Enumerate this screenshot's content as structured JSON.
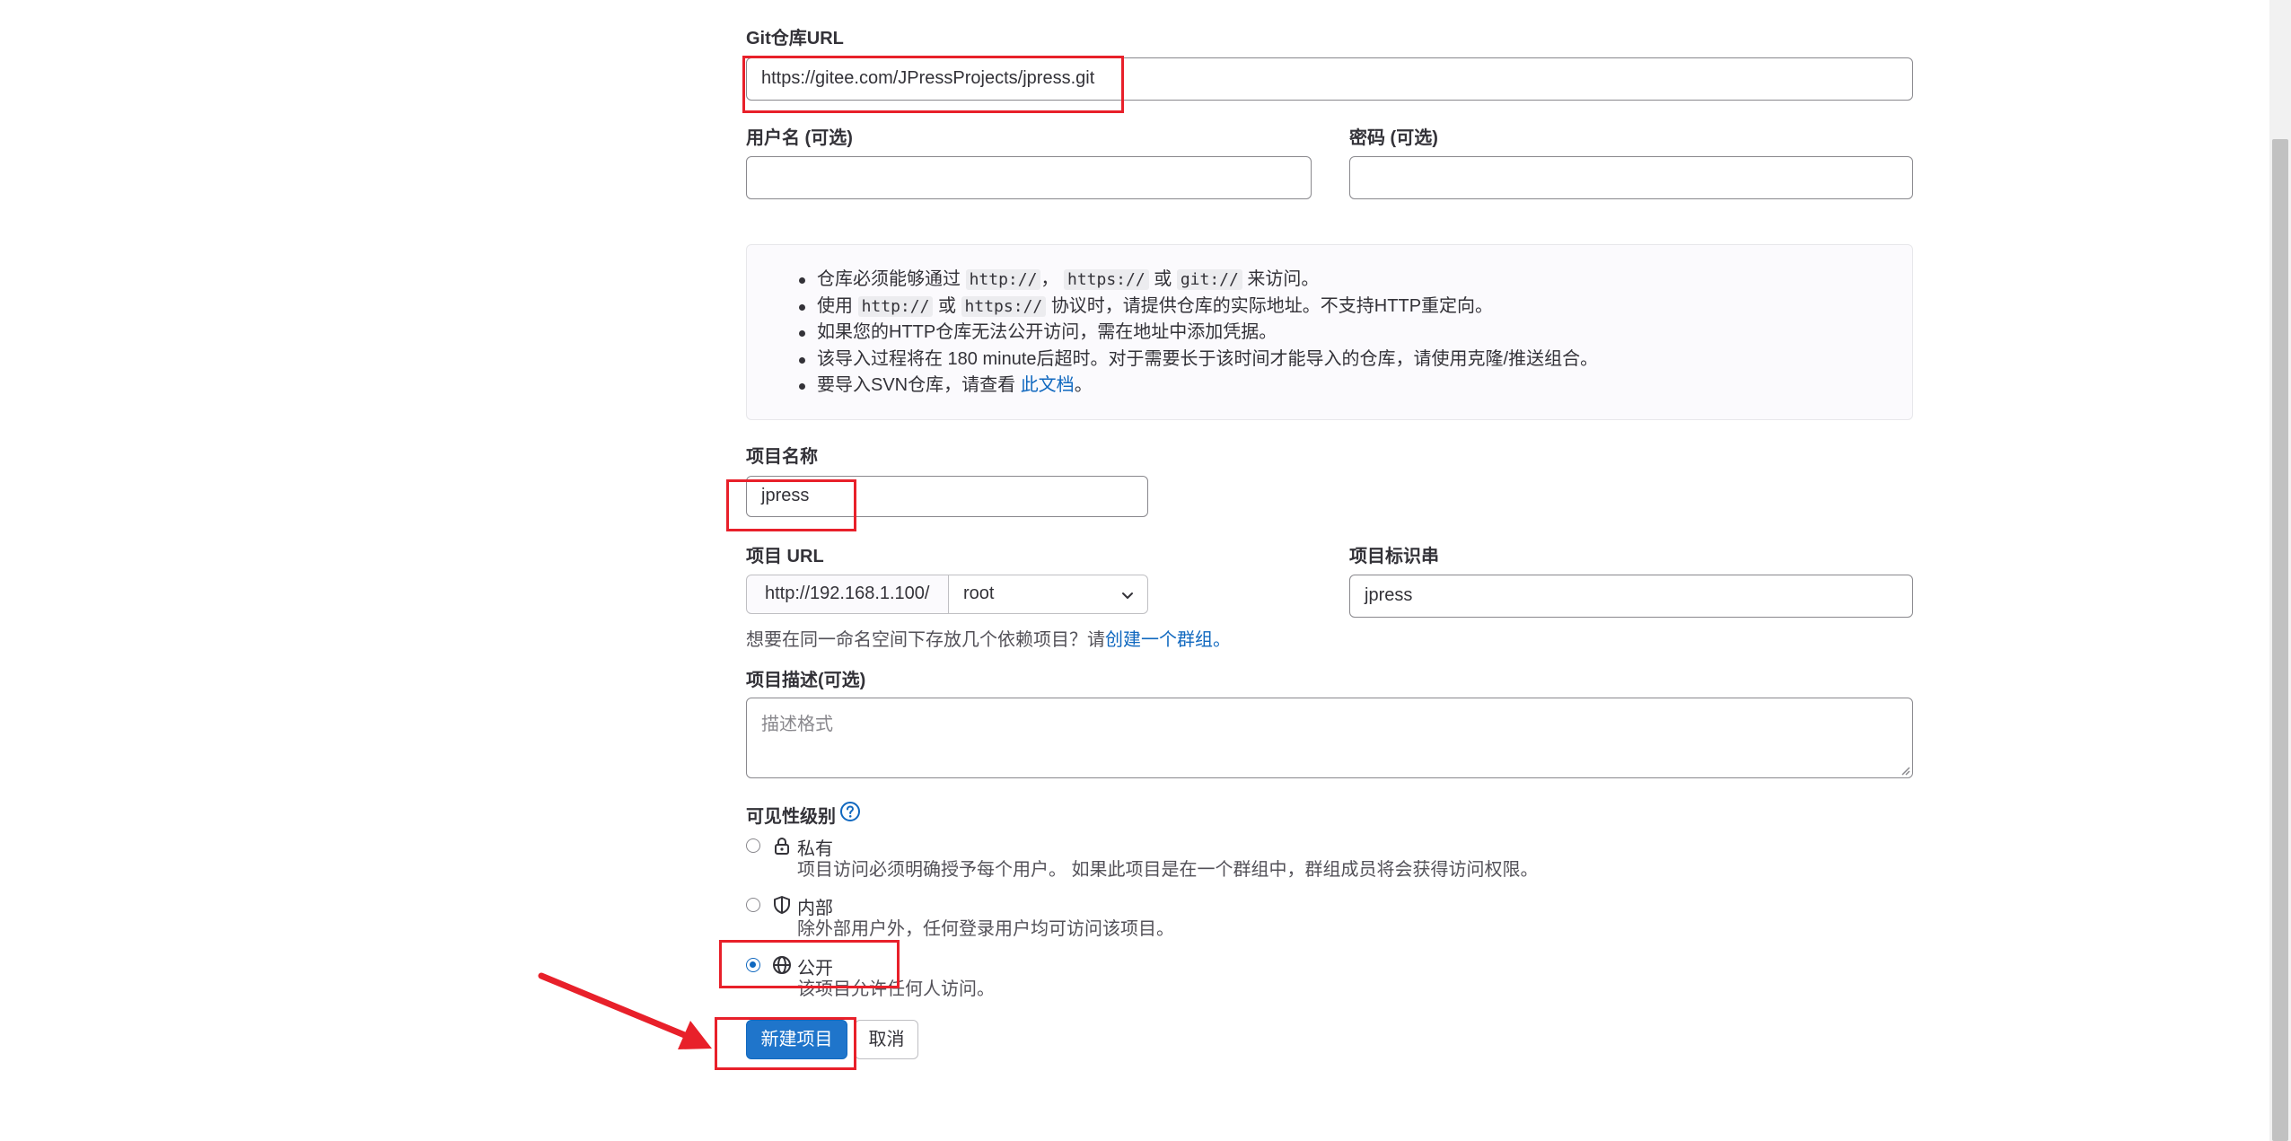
{
  "form": {
    "repo_url": {
      "label": "Git仓库URL",
      "value": "https://gitee.com/JPressProjects/jpress.git"
    },
    "username": {
      "label": "用户名 (可选)",
      "value": ""
    },
    "password": {
      "label": "密码 (可选)",
      "value": ""
    },
    "info": {
      "line1": {
        "pre": "仓库必须能够通过",
        "code1": "http://",
        "sep": "，",
        "code2": "https://",
        "or": "或",
        "code3": "git://",
        "post": "来访问。"
      },
      "line2": {
        "pre": "使用",
        "code1": "http://",
        "or": "或",
        "code2": "https://",
        "post": "协议时，请提供仓库的实际地址。不支持HTTP重定向。"
      },
      "line3": "如果您的HTTP仓库无法公开访问，需在地址中添加凭据。",
      "line4": "该导入过程将在 180 minute后超时。对于需要长于该时间才能导入的仓库，请使用克隆/推送组合。",
      "line5": {
        "pre": "要导入SVN仓库，请查看 ",
        "link": "此文档",
        "post": "。"
      }
    },
    "project_name": {
      "label": "项目名称",
      "value": "jpress"
    },
    "project_url": {
      "label": "项目 URL",
      "prefix": "http://192.168.1.100/",
      "namespace": "root"
    },
    "project_slug": {
      "label": "项目标识串",
      "value": "jpress"
    },
    "group_help": {
      "text": "想要在同一命名空间下存放几个依赖项目？请",
      "link": "创建一个群组。"
    },
    "description": {
      "label": "项目描述(可选)",
      "placeholder": "描述格式"
    },
    "visibility": {
      "label": "可见性级别",
      "options": [
        {
          "icon": "lock-icon",
          "title": "私有",
          "desc": "项目访问必须明确授予每个用户。 如果此项目是在一个群组中，群组成员将会获得访问权限。",
          "checked": false
        },
        {
          "icon": "shield-icon",
          "title": "内部",
          "desc": "除外部用户外，任何登录用户均可访问该项目。",
          "checked": false
        },
        {
          "icon": "globe-icon",
          "title": "公开",
          "desc": "该项目允许任何人访问。",
          "checked": true
        }
      ]
    },
    "buttons": {
      "create": "新建项目",
      "cancel": "取消"
    }
  },
  "annotation": {
    "color": "#e8202a"
  }
}
